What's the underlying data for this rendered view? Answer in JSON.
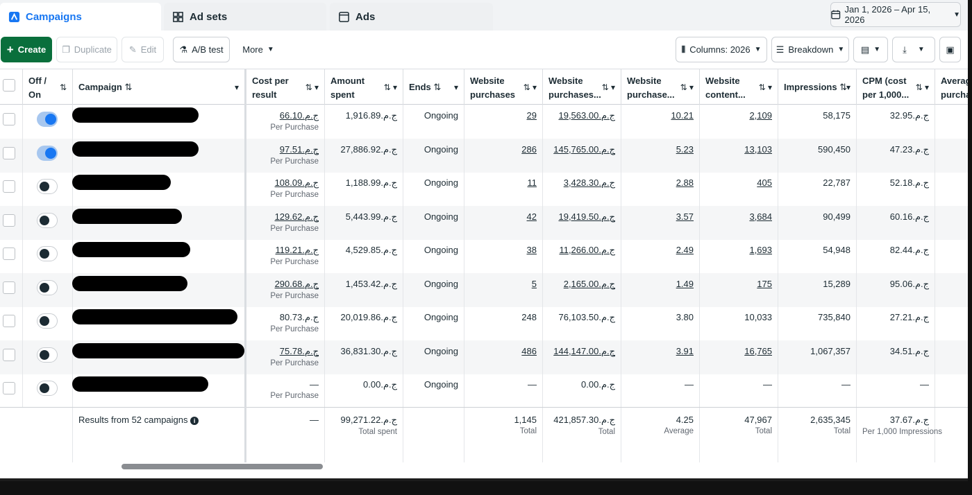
{
  "tabs": {
    "campaigns": "Campaigns",
    "adsets": "Ad sets",
    "ads": "Ads",
    "date_range": "Jan 1, 2026 – Apr 15, 2026"
  },
  "toolbar": {
    "create": "Create",
    "duplicate": "Duplicate",
    "edit": "Edit",
    "ab_test": "A/B test",
    "more": "More",
    "columns": "Columns: 2026",
    "breakdown": "Breakdown"
  },
  "headers": {
    "off_on_1": "Off /",
    "off_on_2": "On",
    "campaign": "Campaign",
    "cost_per_result_1": "Cost per",
    "cost_per_result_2": "result",
    "amount_spent_1": "Amount",
    "amount_spent_2": "spent",
    "ends": "Ends",
    "web_purchases_1": "Website",
    "web_purchases_2": "purchases",
    "web_purchases_value_1": "Website",
    "web_purchases_value_2": "purchases...",
    "web_purchase_roas_1": "Website",
    "web_purchase_roas_2": "purchase...",
    "web_content_1": "Website",
    "web_content_2": "content...",
    "impressions": "Impressions",
    "cpm_1": "CPM (cost",
    "cpm_2": "per 1,000...",
    "avg_1": "Averag",
    "avg_2": "purcha"
  },
  "rows": [
    {
      "on": true,
      "cpr": "66.10.ج.م",
      "cpr_sub": "Per Purchase",
      "spent": "1,916.89.ج.م",
      "ends": "Ongoing",
      "purch": "29",
      "pval": "19,563.00.ج.م",
      "roas": "10.21",
      "content": "2,109",
      "impr": "58,175",
      "cpm": "32.95.ج.م"
    },
    {
      "on": true,
      "cpr": "97.51.ج.م",
      "cpr_sub": "Per Purchase",
      "spent": "27,886.92.ج.م",
      "ends": "Ongoing",
      "purch": "286",
      "pval": "145,765.00.ج.م",
      "roas": "5.23",
      "content": "13,103",
      "impr": "590,450",
      "cpm": "47.23.ج.م"
    },
    {
      "on": false,
      "cpr": "108.09.ج.م",
      "cpr_sub": "Per Purchase",
      "spent": "1,188.99.ج.م",
      "ends": "Ongoing",
      "purch": "11",
      "pval": "3,428.30.ج.م",
      "roas": "2.88",
      "content": "405",
      "impr": "22,787",
      "cpm": "52.18.ج.م"
    },
    {
      "on": false,
      "cpr": "129.62.ج.م",
      "cpr_sub": "Per Purchase",
      "spent": "5,443.99.ج.م",
      "ends": "Ongoing",
      "purch": "42",
      "pval": "19,419.50.ج.م",
      "roas": "3.57",
      "content": "3,684",
      "impr": "90,499",
      "cpm": "60.16.ج.م"
    },
    {
      "on": false,
      "cpr": "119.21.ج.م",
      "cpr_sub": "Per Purchase",
      "spent": "4,529.85.ج.م",
      "ends": "Ongoing",
      "purch": "38",
      "pval": "11,266.00.ج.م",
      "roas": "2.49",
      "content": "1,693",
      "impr": "54,948",
      "cpm": "82.44.ج.م"
    },
    {
      "on": false,
      "cpr": "290.68.ج.م",
      "cpr_sub": "Per Purchase",
      "spent": "1,453.42.ج.م",
      "ends": "Ongoing",
      "purch": "5",
      "pval": "2,165.00.ج.م",
      "roas": "1.49",
      "content": "175",
      "impr": "15,289",
      "cpm": "95.06.ج.م"
    },
    {
      "on": false,
      "cpr": "80.73.ج.م",
      "cpr_sub": "Per Purchase",
      "spent": "20,019.86.ج.م",
      "ends": "Ongoing",
      "purch": "248",
      "pval": "76,103.50.ج.م",
      "roas": "3.80",
      "content": "10,033",
      "impr": "735,840",
      "cpm": "27.21.ج.م"
    },
    {
      "on": false,
      "cpr": "75.78.ج.م",
      "cpr_sub": "Per Purchase",
      "spent": "36,831.30.ج.م",
      "ends": "Ongoing",
      "purch": "486",
      "pval": "144,147.00.ج.م",
      "roas": "3.91",
      "content": "16,765",
      "impr": "1,067,357",
      "cpm": "34.51.ج.م"
    },
    {
      "on": false,
      "cpr": "—",
      "cpr_sub": "Per Purchase",
      "spent": "0.00.ج.م",
      "ends": "Ongoing",
      "purch": "—",
      "pval": "0.00.ج.م",
      "roas": "—",
      "content": "—",
      "impr": "—",
      "cpm": "—"
    }
  ],
  "summary": {
    "label": "Results from 52 campaigns",
    "cpr": "—",
    "spent": "99,271.22.ج.م",
    "spent_sub": "Total spent",
    "purch": "1,145",
    "purch_sub": "Total",
    "pval": "421,857.30.ج.م",
    "pval_sub": "Total",
    "roas": "4.25",
    "roas_sub": "Average",
    "content": "47,967",
    "content_sub": "Total",
    "impr": "2,635,345",
    "impr_sub": "Total",
    "cpm": "37.67.ج.م",
    "cpm_sub": "Per 1,000 Impressions"
  },
  "colors": {
    "accent": "#1877f2",
    "create": "#0a6f3c"
  }
}
